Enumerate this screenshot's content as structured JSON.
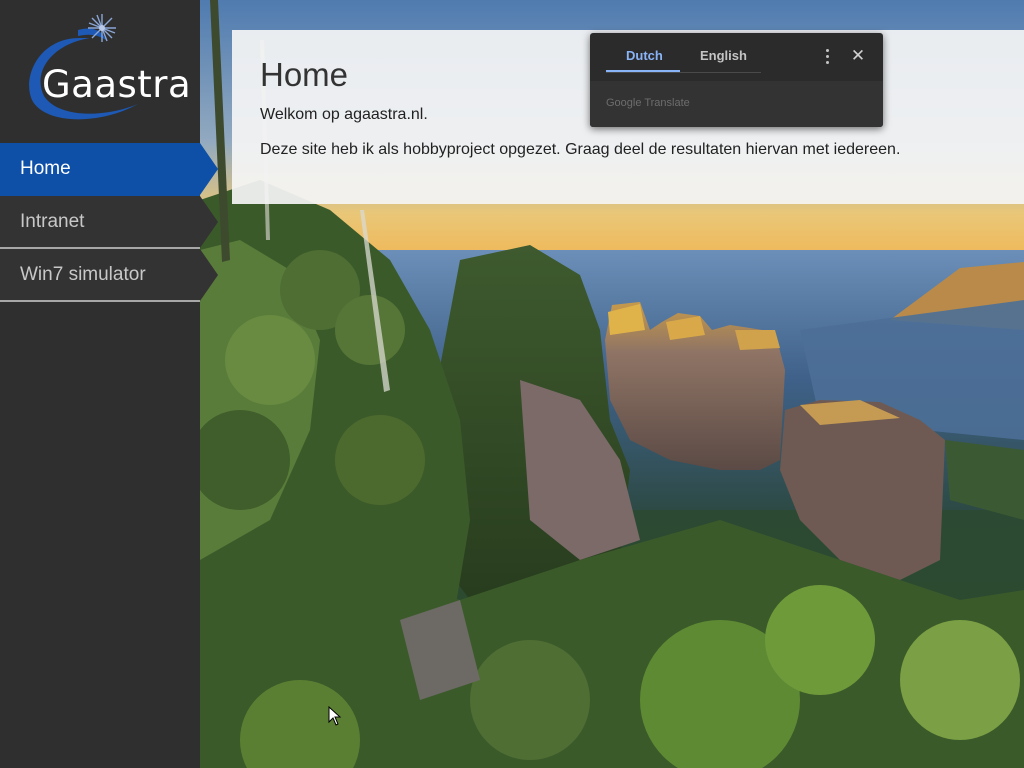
{
  "brand": {
    "logo_text": "Gaastra",
    "logo_icon": "star-burst-icon",
    "accent_color": "#0e4fa8"
  },
  "sidebar": {
    "items": [
      {
        "label": "Home",
        "active": true
      },
      {
        "label": "Intranet",
        "active": false
      },
      {
        "label": "Win7 simulator",
        "active": false
      }
    ]
  },
  "main": {
    "title": "Home",
    "welcome": "Welkom op agaastra.nl.",
    "intro": "Deze site heb ik als hobbyproject opgezet. Graag deel de resultaten hiervan met iedereen.",
    "background_image": "blue-mountains-three-sisters-landscape"
  },
  "translate_popup": {
    "tabs": [
      {
        "label": "Dutch",
        "active": true
      },
      {
        "label": "English",
        "active": false
      }
    ],
    "menu_icon": "more-vert-icon",
    "close_icon": "close-icon",
    "brand_text": "Google Translate",
    "accent_color": "#8ab4f8"
  }
}
